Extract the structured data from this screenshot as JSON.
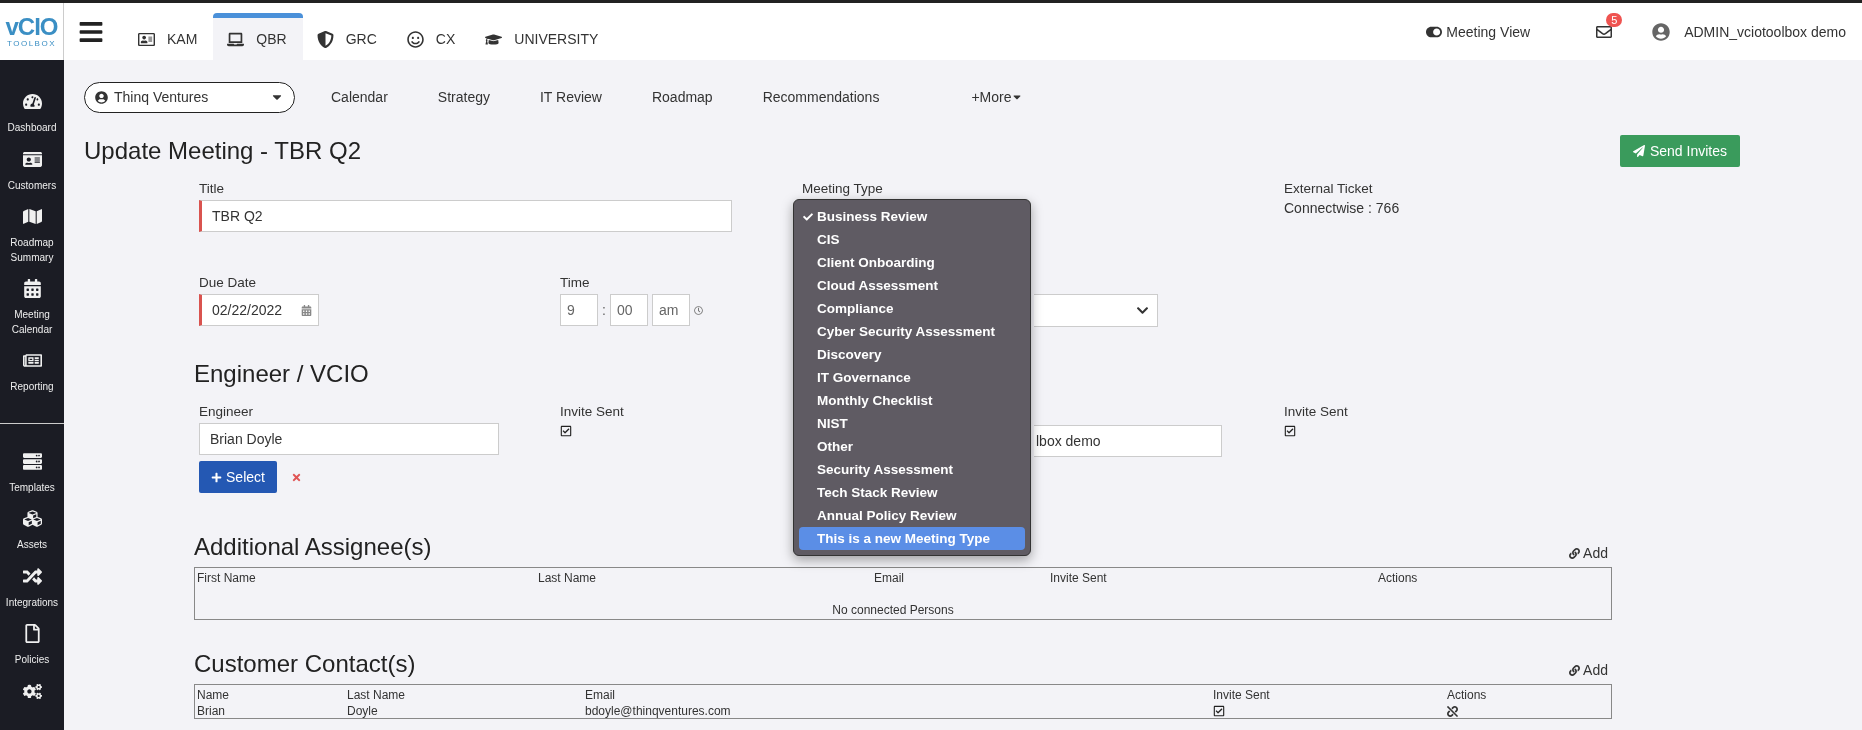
{
  "logo": {
    "text": "vCIO",
    "subtext": "TOOLBOX"
  },
  "top_tabs": [
    {
      "label": "KAM",
      "selected": false
    },
    {
      "label": "QBR",
      "selected": true
    },
    {
      "label": "GRC",
      "selected": false
    },
    {
      "label": "CX",
      "selected": false
    },
    {
      "label": "UNIVERSITY",
      "selected": false
    }
  ],
  "header_right": {
    "meeting_view": {
      "label": "Meeting View",
      "on": true
    },
    "mail_count": "5",
    "user": "ADMIN_vciotoolbox demo"
  },
  "sidebar": {
    "groups": [
      [
        {
          "label": "Dashboard"
        },
        {
          "label": "Customers"
        },
        {
          "label": "Roadmap Summary"
        },
        {
          "label": "Meeting Calendar"
        },
        {
          "label": "Reporting"
        }
      ],
      [
        {
          "label": "Templates"
        },
        {
          "label": "Assets"
        },
        {
          "label": "Integrations"
        },
        {
          "label": "Policies"
        }
      ]
    ]
  },
  "subnav": {
    "customer": "Thinq Ventures",
    "links": [
      "Calendar",
      "Strategy",
      "IT Review",
      "Roadmap",
      "Recommendations"
    ],
    "more": "+More"
  },
  "page_title": "Update Meeting - TBR Q2",
  "send_button": "Send Invites",
  "form": {
    "title": {
      "label": "Title",
      "value": "TBR Q2"
    },
    "meeting_type": {
      "label": "Meeting Type",
      "options": [
        {
          "label": "Business Review",
          "checked": true,
          "highlighted": false
        },
        {
          "label": "CIS",
          "checked": false,
          "highlighted": false
        },
        {
          "label": "Client Onboarding",
          "checked": false,
          "highlighted": false
        },
        {
          "label": "Cloud Assessment",
          "checked": false,
          "highlighted": false
        },
        {
          "label": "Compliance",
          "checked": false,
          "highlighted": false
        },
        {
          "label": "Cyber Security Assessment",
          "checked": false,
          "highlighted": false
        },
        {
          "label": "Discovery",
          "checked": false,
          "highlighted": false
        },
        {
          "label": "IT Governance",
          "checked": false,
          "highlighted": false
        },
        {
          "label": "Monthly Checklist",
          "checked": false,
          "highlighted": false
        },
        {
          "label": "NIST",
          "checked": false,
          "highlighted": false
        },
        {
          "label": "Other",
          "checked": false,
          "highlighted": false
        },
        {
          "label": "Security Assessment",
          "checked": false,
          "highlighted": false
        },
        {
          "label": "Tech Stack Review",
          "checked": false,
          "highlighted": false
        },
        {
          "label": "Annual Policy Review",
          "checked": false,
          "highlighted": false
        },
        {
          "label": "This is a new Meeting Type",
          "checked": false,
          "highlighted": true
        }
      ]
    },
    "external_ticket": {
      "label": "External Ticket",
      "value": "Connectwise : 766"
    },
    "due_date": {
      "label": "Due Date",
      "value": "02/22/2022"
    },
    "time": {
      "label": "Time",
      "hour": "9",
      "separator": ":",
      "minute": "00",
      "period": "am"
    }
  },
  "engineer_section": {
    "heading": "Engineer / VCIO",
    "engineer": {
      "label": "Engineer",
      "value": "Brian Doyle"
    },
    "select_button": "Select",
    "invite_sent": {
      "label": "Invite Sent",
      "checked": true
    },
    "vcio": {
      "value": "lbox demo"
    },
    "vcio_invite_sent": {
      "label": "Invite Sent",
      "checked": true
    }
  },
  "assignees": {
    "heading": "Additional Assignee(s)",
    "add": "Add",
    "columns": [
      "First Name",
      "Last Name",
      "Email",
      "Invite Sent",
      "Actions"
    ],
    "empty": "No connected Persons"
  },
  "contacts": {
    "heading": "Customer Contact(s)",
    "add": "Add",
    "columns": [
      "Name",
      "Last Name",
      "Email",
      "Invite Sent",
      "Actions"
    ],
    "rows": [
      {
        "name": "Brian",
        "last_name": "Doyle",
        "email": "bdoyle@thinqventures.com",
        "invite_sent": true
      }
    ]
  }
}
